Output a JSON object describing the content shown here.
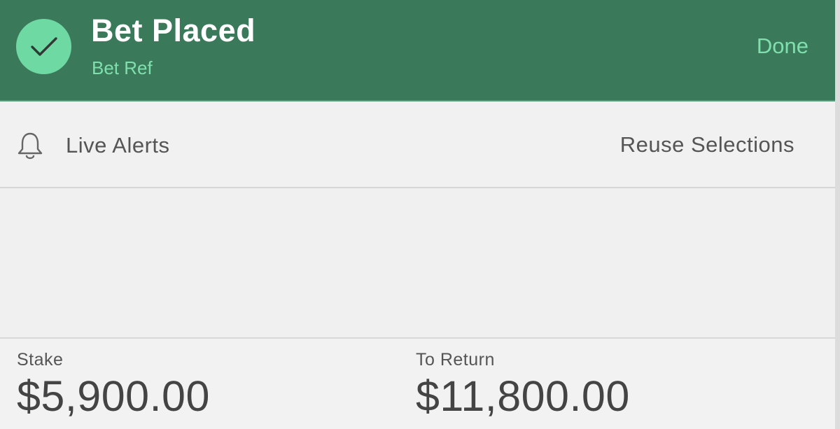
{
  "header": {
    "title": "Bet Placed",
    "subtitle": "Bet Ref",
    "done_label": "Done",
    "status_icon": "checkmark-icon",
    "colors": {
      "background": "#3a7a5a",
      "accent": "#7fe0ae",
      "check_circle": "#6fd9a4"
    }
  },
  "actions": {
    "live_alerts_icon": "bell-icon",
    "live_alerts_label": "Live Alerts",
    "reuse_label": "Reuse Selections"
  },
  "totals": {
    "stake_label": "Stake",
    "stake_value": "$5,900.00",
    "return_label": "To Return",
    "return_value": "$11,800.00"
  }
}
